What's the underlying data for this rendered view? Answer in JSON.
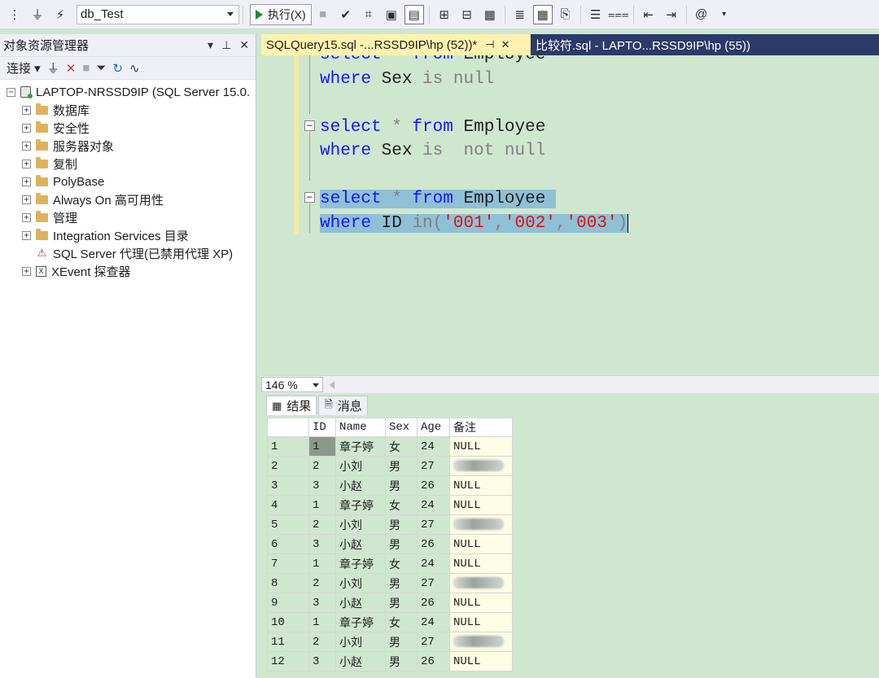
{
  "toolbar": {
    "database": "db_Test",
    "execute_label": "执行(X)"
  },
  "object_explorer": {
    "title": "对象资源管理器",
    "connect_label": "连接",
    "server": "LAPTOP-NRSSD9IP (SQL Server 15.0.",
    "nodes": [
      {
        "label": "数据库",
        "expandable": true
      },
      {
        "label": "安全性",
        "expandable": true
      },
      {
        "label": "服务器对象",
        "expandable": true
      },
      {
        "label": "复制",
        "expandable": true
      },
      {
        "label": "PolyBase",
        "expandable": true
      },
      {
        "label": "Always On 高可用性",
        "expandable": true
      },
      {
        "label": "管理",
        "expandable": true
      },
      {
        "label": "Integration Services 目录",
        "expandable": true
      },
      {
        "label": "SQL Server 代理(已禁用代理 XP)",
        "expandable": false
      },
      {
        "label": "XEvent 探查器",
        "expandable": true
      }
    ]
  },
  "tabs": {
    "active": "SQLQuery15.sql -...RSSD9IP\\hp (52))*",
    "inactive": "比较符.sql - LAPTO...RSSD9IP\\hp (55))"
  },
  "editor": {
    "lines": [
      "select * from Employee",
      "where Sex is null",
      "",
      "select * from Employee",
      "where Sex is  not null",
      "",
      "select * from Employee",
      "where ID in('001','002','003')"
    ]
  },
  "zoom": "146 %",
  "results": {
    "tab_results": "结果",
    "tab_messages": "消息",
    "columns": [
      "ID",
      "Name",
      "Sex",
      "Age",
      "备注"
    ],
    "rows": [
      [
        "1",
        "1",
        "章子婷",
        "女",
        "24",
        "NULL"
      ],
      [
        "2",
        "2",
        "小刘",
        "男",
        "27",
        ""
      ],
      [
        "3",
        "3",
        "小赵",
        "男",
        "26",
        "NULL"
      ],
      [
        "4",
        "1",
        "章子婷",
        "女",
        "24",
        "NULL"
      ],
      [
        "5",
        "2",
        "小刘",
        "男",
        "27",
        ""
      ],
      [
        "6",
        "3",
        "小赵",
        "男",
        "26",
        "NULL"
      ],
      [
        "7",
        "1",
        "章子婷",
        "女",
        "24",
        "NULL"
      ],
      [
        "8",
        "2",
        "小刘",
        "男",
        "27",
        ""
      ],
      [
        "9",
        "3",
        "小赵",
        "男",
        "26",
        "NULL"
      ],
      [
        "10",
        "1",
        "章子婷",
        "女",
        "24",
        "NULL"
      ],
      [
        "11",
        "2",
        "小刘",
        "男",
        "27",
        ""
      ],
      [
        "12",
        "3",
        "小赵",
        "男",
        "26",
        "NULL"
      ]
    ]
  },
  "colors": {
    "editor_bg": "#cfe7cf",
    "keyword": "#1414ff",
    "string": "#e01010",
    "operator": "#808080",
    "tab_strip": "#2b3a68",
    "active_tab": "#fff2b0",
    "selection": "#8fc0d6"
  }
}
